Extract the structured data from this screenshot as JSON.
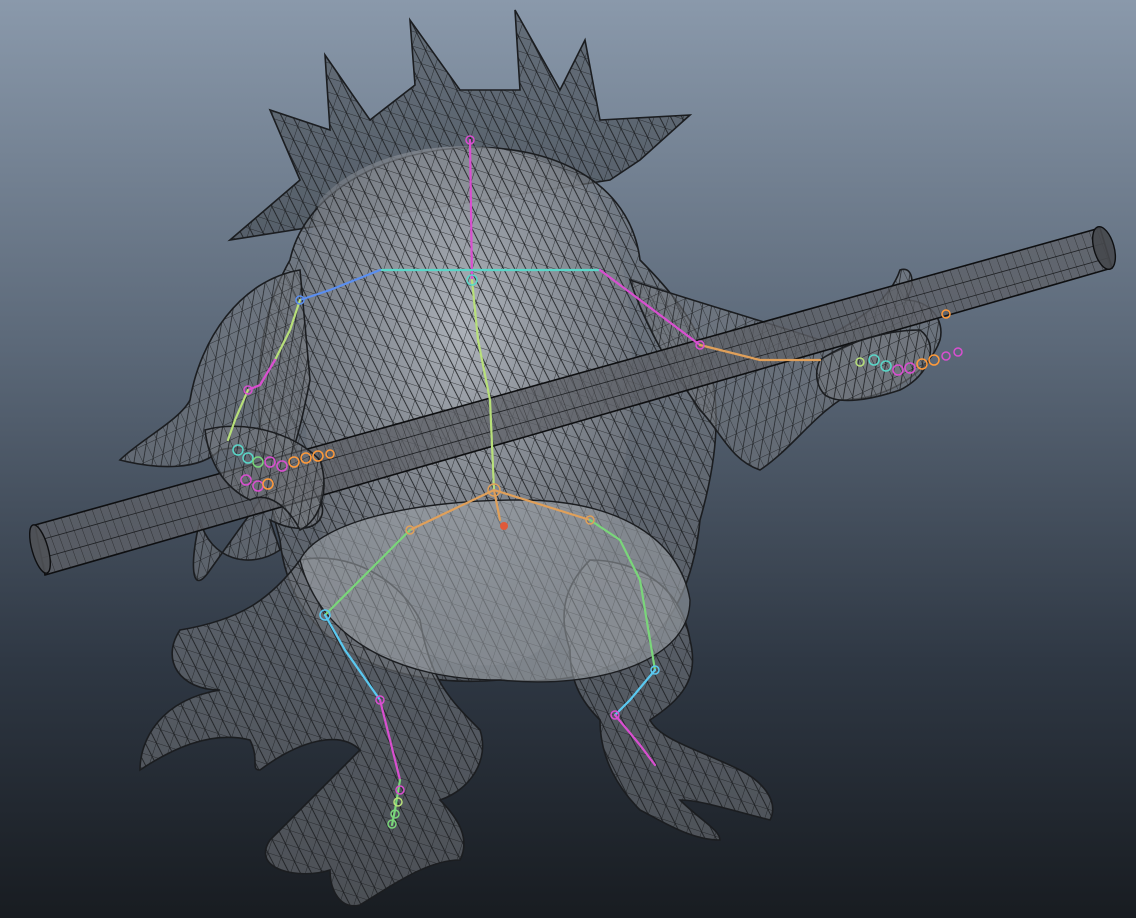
{
  "viewport": {
    "background_top": "#8a99ab",
    "background_bottom": "#181c21",
    "display_mode": "wireframe-on-shaded",
    "visible_text": []
  },
  "scene": {
    "objects": [
      "creature-mesh",
      "staff-cylinder",
      "skeleton-joints"
    ]
  },
  "colors": {
    "wire": "#1b1d20",
    "mesh": "#787c82",
    "spine": "#b8e07a",
    "collar": "#5ad6c8",
    "arm": "#d94fd0",
    "pelvis": "#e0a05a",
    "leg_left": "#5ac8f0",
    "leg_right": "#7ad67a",
    "finger": "#ff9a3a"
  }
}
